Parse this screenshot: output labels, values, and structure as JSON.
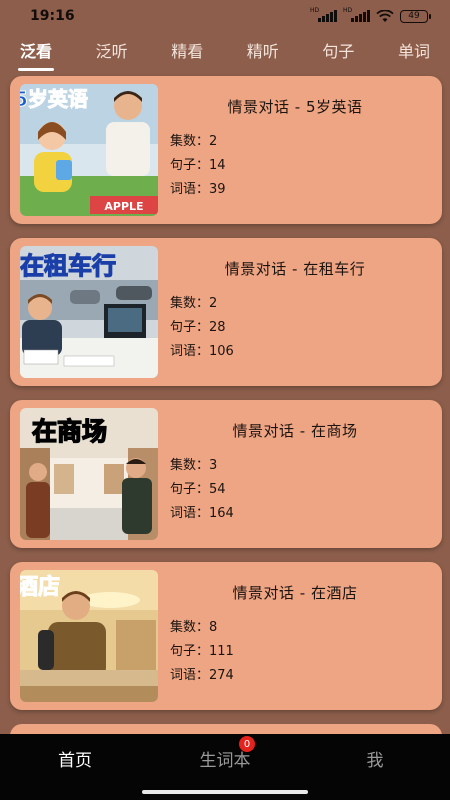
{
  "status_bar": {
    "time": "19:16",
    "signal1_tag": "HD",
    "signal2_tag": "HD",
    "battery": "49"
  },
  "tabs": [
    {
      "label": "泛看",
      "active": true
    },
    {
      "label": "泛听",
      "active": false
    },
    {
      "label": "精看",
      "active": false
    },
    {
      "label": "精听",
      "active": false
    },
    {
      "label": "句子",
      "active": false
    },
    {
      "label": "单词",
      "active": false
    }
  ],
  "cards": [
    {
      "title": "情景对话 - 5岁英语",
      "thumb_text": "5岁英语",
      "thumb_sub": "APPLE",
      "episodes": "集数：2",
      "sentences": "句子：14",
      "words": "词语：39"
    },
    {
      "title": "情景对话 - 在租车行",
      "thumb_text": "在租车行",
      "episodes": "集数：2",
      "sentences": "句子：28",
      "words": "词语：106"
    },
    {
      "title": "情景对话 - 在商场",
      "thumb_text": "在商场",
      "episodes": "集数：3",
      "sentences": "句子：54",
      "words": "词语：164"
    },
    {
      "title": "情景对话 - 在酒店",
      "thumb_text": "酒店",
      "episodes": "集数：8",
      "sentences": "句子：111",
      "words": "词语：274"
    }
  ],
  "bottom_nav": {
    "home": "首页",
    "vocab": "生词本",
    "vocab_badge": "0",
    "me": "我"
  },
  "colors": {
    "background": "#8c5e4b",
    "card": "#eea584",
    "nav_bg": "#050505",
    "badge": "#e5231d"
  }
}
